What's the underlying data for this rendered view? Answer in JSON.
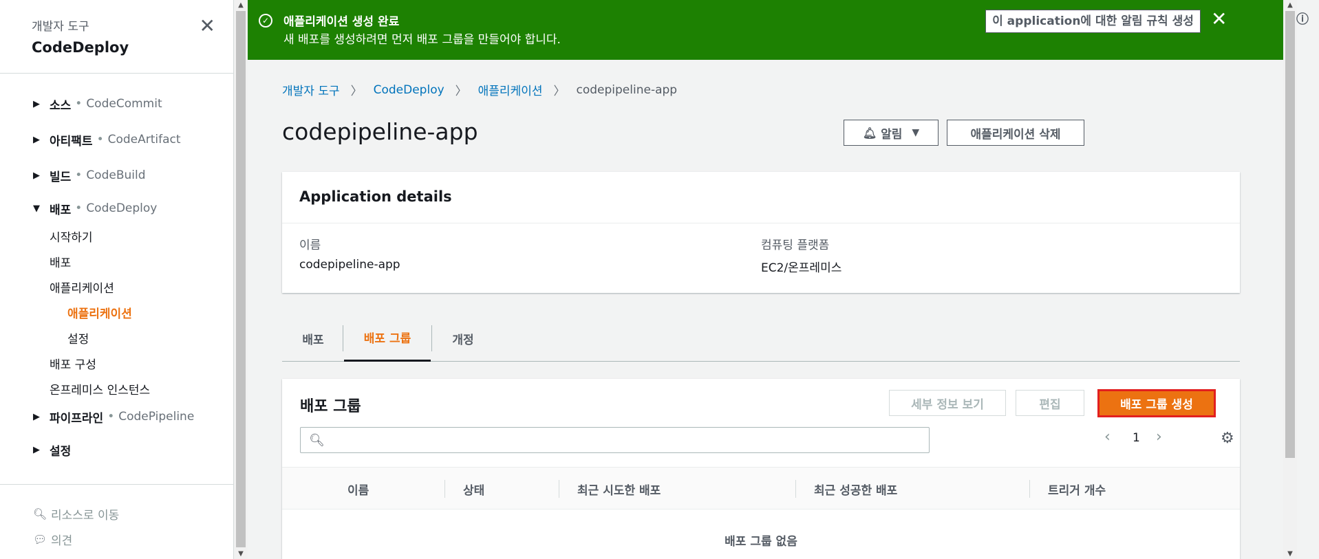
{
  "sidebar": {
    "subtitle": "개발자 도구",
    "title": "CodeDeploy",
    "sections": [
      {
        "label": "소스",
        "service": "CodeCommit"
      },
      {
        "label": "아티팩트",
        "service": "CodeArtifact"
      },
      {
        "label": "빌드",
        "service": "CodeBuild"
      },
      {
        "label": "배포",
        "service": "CodeDeploy"
      },
      {
        "label": "파이프라인",
        "service": "CodePipeline"
      },
      {
        "label": "설정",
        "service": ""
      }
    ],
    "deploy_items": [
      "시작하기",
      "배포",
      "애플리케이션",
      "애플리케이션",
      "설정",
      "배포 구성",
      "온프레미스 인스턴스"
    ],
    "footer": [
      "리소스로 이동",
      "의견"
    ]
  },
  "flash": {
    "title": "애플리케이션 생성 완료",
    "message": "새 배포를 생성하려면 먼저 배포 그룹을 만들어야 합니다.",
    "button": "이 application에 대한 알림 규칙 생성"
  },
  "breadcrumb": [
    "개발자 도구",
    "CodeDeploy",
    "애플리케이션",
    "codepipeline-app"
  ],
  "page": {
    "title": "codepipeline-app",
    "notify_button": "알림",
    "delete_button": "애플리케이션 삭제"
  },
  "details": {
    "header": "Application details",
    "name_label": "이름",
    "name_value": "codepipeline-app",
    "platform_label": "컴퓨팅 플랫폼",
    "platform_value": "EC2/온프레미스"
  },
  "tabs": [
    "배포",
    "배포 그룹",
    "개정"
  ],
  "groups": {
    "title": "배포 그룹",
    "view_button": "세부 정보 보기",
    "edit_button": "편집",
    "create_button": "배포 그룹 생성",
    "page": "1",
    "columns": [
      "이름",
      "상태",
      "최근 시도한 배포",
      "최근 성공한 배포",
      "트리거 개수"
    ],
    "empty": "배포 그룹 없음"
  },
  "colors": {
    "success": "#1d8102",
    "accent": "#ec7211",
    "link": "#0073bb",
    "highlight": "#e21f1f"
  }
}
